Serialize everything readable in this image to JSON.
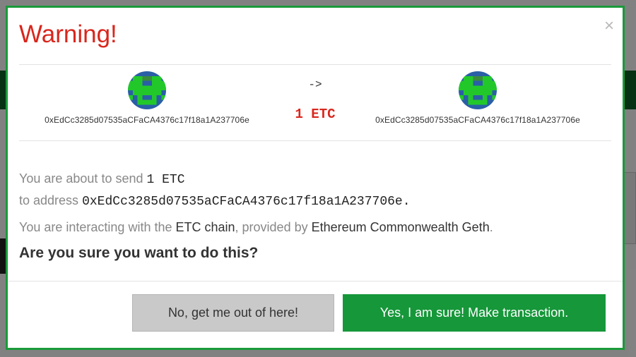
{
  "modal": {
    "title": "Warning!",
    "close_label": "×",
    "from_address": "0xEdCc3285d07535aCFaCA4376c17f18a1A237706e",
    "to_address": "0xEdCc3285d07535aCFaCA4376c17f18a1A237706e",
    "arrow": "->",
    "amount": "1 ETC",
    "details": {
      "send_prefix": "You are about to send ",
      "send_amount": "1 ETC",
      "to_prefix": "to address ",
      "to_address_full": "0xEdCc3285d07535aCFaCA4376c17f18a1A237706e.",
      "chain_prefix": "You are interacting with the ",
      "chain_name": "ETC chain",
      "provider_prefix": ", provided by ",
      "provider_name": "Ethereum Commonwealth Geth",
      "provider_suffix": "."
    },
    "question": "Are you sure you want to do this?",
    "cancel_label": "No, get me out of here!",
    "confirm_label": "Yes, I am sure! Make transaction."
  },
  "colors": {
    "title": "#d9261c",
    "border": "#1a9a3a",
    "confirm": "#16973a",
    "cancel": "#c9c9c9",
    "identicon_green": "#22c82a",
    "identicon_blue": "#2a5fa6"
  },
  "icons": {
    "from_identicon": "identicon",
    "to_identicon": "identicon",
    "close": "close-icon"
  }
}
